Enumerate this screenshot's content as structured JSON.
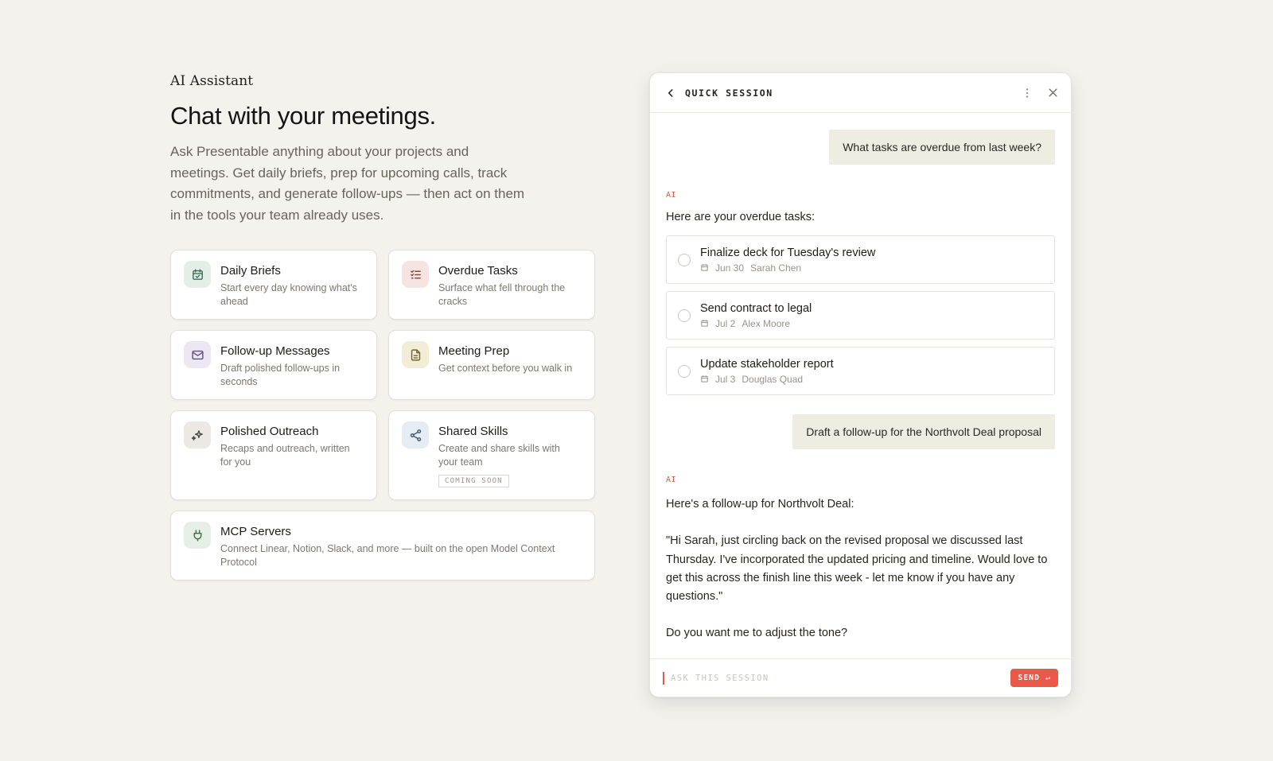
{
  "hero": {
    "eyebrow": "AI Assistant",
    "headline": "Chat with your meetings.",
    "intro": "Ask Presentable anything about your projects and meetings. Get daily briefs, prep for upcoming calls, track commitments, and generate follow-ups — then act on them in the tools your team already uses."
  },
  "features": [
    {
      "title": "Daily Briefs",
      "desc": "Start every day knowing what's ahead",
      "icon": "calendar-check-icon",
      "color": "#e3eee8",
      "stroke": "#3f6b55"
    },
    {
      "title": "Overdue Tasks",
      "desc": "Surface what fell through the cracks",
      "icon": "list-check-icon",
      "color": "#f6e4e2",
      "stroke": "#8a4a44"
    },
    {
      "title": "Follow-up Messages",
      "desc": "Draft polished follow-ups in seconds",
      "icon": "mail-icon",
      "color": "#ece7f3",
      "stroke": "#5f4f7e"
    },
    {
      "title": "Meeting Prep",
      "desc": "Get context before you walk in",
      "icon": "document-icon",
      "color": "#f3edd6",
      "stroke": "#6f6336"
    },
    {
      "title": "Polished Outreach",
      "desc": "Recaps and outreach, written for you",
      "icon": "sparkle-icon",
      "color": "#ece9e4",
      "stroke": "#4d4a44"
    },
    {
      "title": "Shared Skills",
      "desc": "Create and share skills with your team",
      "badge": "COMING SOON",
      "icon": "share-icon",
      "color": "#e6ecf4",
      "stroke": "#44597a"
    },
    {
      "title": "MCP Servers",
      "desc": "Connect Linear, Notion, Slack, and more — built on the open Model Context Protocol",
      "icon": "plug-icon",
      "color": "#e6efe6",
      "stroke": "#3f6b45"
    }
  ],
  "chat": {
    "title": "QUICK SESSION",
    "ai_label": "AI",
    "messages": {
      "q1": "What tasks are overdue from last week?",
      "a1_intro": "Here are your overdue tasks:",
      "tasks": [
        {
          "title": "Finalize deck for Tuesday's review",
          "date": "Jun 30",
          "owner": "Sarah Chen"
        },
        {
          "title": "Send contract to legal",
          "date": "Jul 2",
          "owner": "Alex Moore"
        },
        {
          "title": "Update stakeholder report",
          "date": "Jul 3",
          "owner": "Douglas Quad"
        }
      ],
      "q2": "Draft a follow-up for the Northvolt Deal proposal",
      "a2_intro": "Here's a follow-up for Northvolt Deal:",
      "a2_body": "\"Hi Sarah, just circling back on the revised proposal we discussed last Thursday. I've incorporated the updated pricing and timeline. Would love to get this across the finish line this week - let me know if you have any questions.\"",
      "a2_outro": "Do you want me to adjust the tone?"
    },
    "composer": {
      "placeholder": "ASK THIS SESSION",
      "send_label": "SEND ↵"
    }
  },
  "colors": {
    "background": "#f3f2ed",
    "accent": "#e8594a",
    "user_bubble": "#efece2"
  }
}
